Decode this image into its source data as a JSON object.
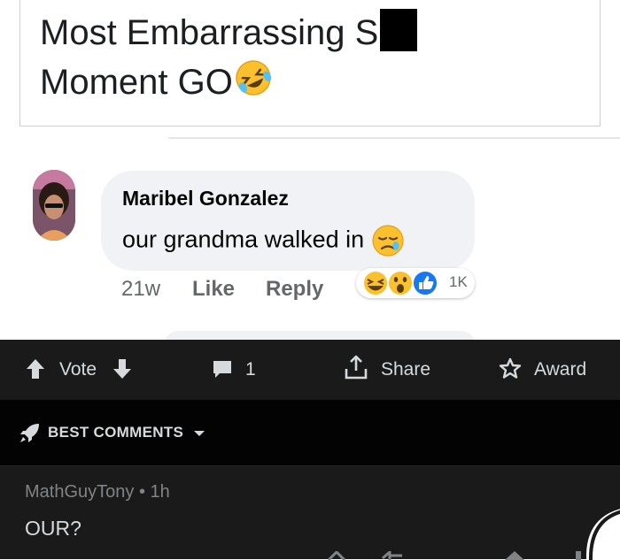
{
  "post": {
    "line1": "Most Embarrassing S",
    "line2": "Moment GO"
  },
  "comment": {
    "author": "Maribel Gonzalez",
    "text": "our grandma walked in",
    "time": "21w",
    "like_label": "Like",
    "reply_label": "Reply",
    "reaction_count": "1K",
    "reactions": [
      "laughing-emoji",
      "wow-emoji",
      "thumbs-up-icon"
    ]
  },
  "reddit": {
    "vote_label": "Vote",
    "comment_count": "1",
    "share_label": "Share",
    "award_label": "Award",
    "sort_label": "BEST COMMENTS",
    "top_comment": {
      "author": "MathGuyTony",
      "dot": "•",
      "time": "1h",
      "text": "OUR?"
    }
  },
  "colors": {
    "reddit_bg": "#1a1a1b",
    "reddit_sort_bg": "#030303",
    "reddit_text": "#d7dadc",
    "reddit_meta": "#818384",
    "fb_bubble": "#f0f2f5",
    "fb_name": "#050505",
    "fb_meta": "#65676b",
    "like_blue": "#1877f2",
    "emoji_yellow": "#fbc02d"
  }
}
